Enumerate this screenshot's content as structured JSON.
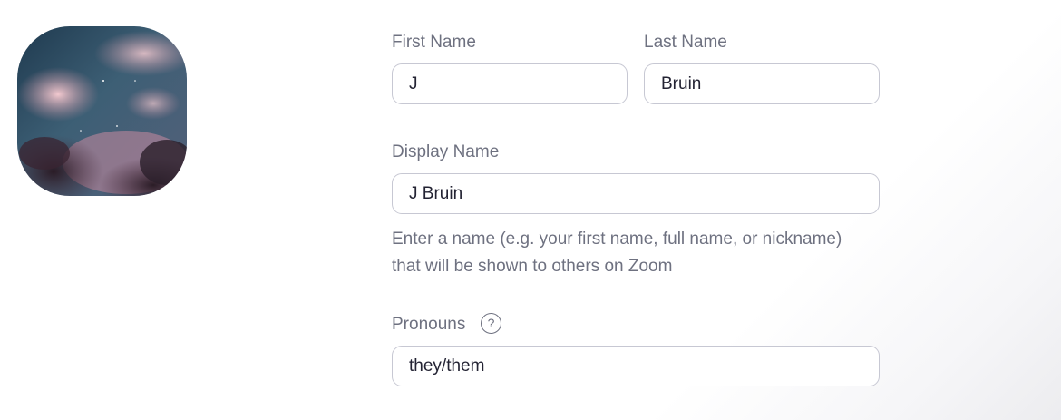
{
  "profile": {
    "avatar_icon": "profile-picture-cloudy-sky"
  },
  "form": {
    "first_name": {
      "label": "First Name",
      "value": "J"
    },
    "last_name": {
      "label": "Last Name",
      "value": "Bruin"
    },
    "display_name": {
      "label": "Display Name",
      "value": "J Bruin",
      "hint_line1": "Enter a name (e.g. your first name, full name, or nickname)",
      "hint_line2": "that will be shown to others on Zoom"
    },
    "pronouns": {
      "label": "Pronouns",
      "value": "they/them",
      "help_icon": "question-mark-circle-icon",
      "help_glyph": "?"
    }
  },
  "colors": {
    "label_text": "#6e7180",
    "input_text": "#232333",
    "input_border": "#c7c8d3"
  }
}
